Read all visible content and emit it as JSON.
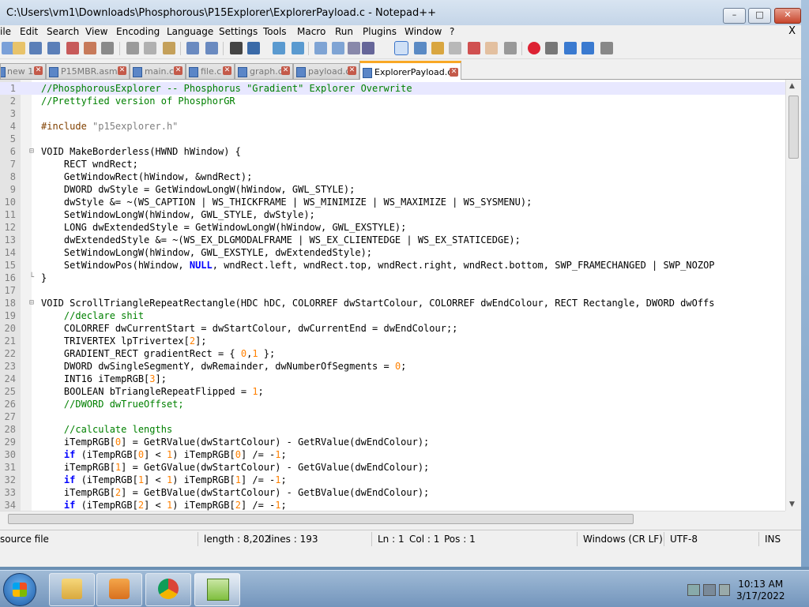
{
  "window": {
    "title": "C:\\Users\\vm1\\Downloads\\Phosphorous\\P15Explorer\\ExplorerPayload.c - Notepad++",
    "min_label": "–",
    "max_label": "□",
    "close_label": "✕"
  },
  "menu": {
    "items": [
      "ile",
      "Edit",
      "Search",
      "View",
      "Encoding",
      "Language",
      "Settings",
      "Tools",
      "Macro",
      "Run",
      "Plugins",
      "Window",
      "?"
    ],
    "close_doc": "X"
  },
  "tabs": [
    {
      "label": "new 1",
      "active": false
    },
    {
      "label": "P15MBR.asm",
      "active": false
    },
    {
      "label": "main.c",
      "active": false
    },
    {
      "label": "file.c",
      "active": false
    },
    {
      "label": "graph.c",
      "active": false
    },
    {
      "label": "payload.c",
      "active": false
    },
    {
      "label": "ExplorerPayload.c",
      "active": true
    }
  ],
  "tab_close_glyph": "✕",
  "code_lines": [
    {
      "n": "1",
      "fold": "",
      "html": "<span class=\"c\">//PhosphorousExplorer -- Phosphorus \"Gradient\" Explorer Overwrite</span>"
    },
    {
      "n": "2",
      "fold": "",
      "html": "<span class=\"c\">//Prettyfied version of PhosphorGR</span>"
    },
    {
      "n": "3",
      "fold": "",
      "html": ""
    },
    {
      "n": "4",
      "fold": "",
      "html": "<span class=\"pp\">#include </span><span class=\"s\">\"p15explorer.h\"</span>"
    },
    {
      "n": "5",
      "fold": "",
      "html": ""
    },
    {
      "n": "6",
      "fold": "⊟",
      "html": "VOID MakeBorderless(HWND hWindow) {"
    },
    {
      "n": "7",
      "fold": "",
      "html": "    RECT wndRect;"
    },
    {
      "n": "8",
      "fold": "",
      "html": "    GetWindowRect(hWindow, &amp;wndRect);"
    },
    {
      "n": "9",
      "fold": "",
      "html": "    DWORD dwStyle = GetWindowLongW(hWindow, GWL_STYLE);"
    },
    {
      "n": "10",
      "fold": "",
      "html": "    dwStyle &amp;= ~(WS_CAPTION | WS_THICKFRAME | WS_MINIMIZE | WS_MAXIMIZE | WS_SYSMENU);"
    },
    {
      "n": "11",
      "fold": "",
      "html": "    SetWindowLongW(hWindow, GWL_STYLE, dwStyle);"
    },
    {
      "n": "12",
      "fold": "",
      "html": "    LONG dwExtendedStyle = GetWindowLongW(hWindow, GWL_EXSTYLE);"
    },
    {
      "n": "13",
      "fold": "",
      "html": "    dwExtendedStyle &amp;= ~(WS_EX_DLGMODALFRAME | WS_EX_CLIENTEDGE | WS_EX_STATICEDGE);"
    },
    {
      "n": "14",
      "fold": "",
      "html": "    SetWindowLongW(hWindow, GWL_EXSTYLE, dwExtendedStyle);"
    },
    {
      "n": "15",
      "fold": "",
      "html": "    SetWindowPos(hWindow, <span class=\"k\">NULL</span>, wndRect.left, wndRect.top, wndRect.right, wndRect.bottom, SWP_FRAMECHANGED | SWP_NOZOP"
    },
    {
      "n": "16",
      "fold": "└",
      "html": "}"
    },
    {
      "n": "17",
      "fold": "",
      "html": ""
    },
    {
      "n": "18",
      "fold": "⊟",
      "html": "VOID ScrollTriangleRepeatRectangle(HDC hDC, COLORREF dwStartColour, COLORREF dwEndColour, RECT Rectangle, DWORD dwOffs"
    },
    {
      "n": "19",
      "fold": "",
      "html": "    <span class=\"c\">//declare shit</span>"
    },
    {
      "n": "20",
      "fold": "",
      "html": "    COLORREF dwCurrentStart = dwStartColour, dwCurrentEnd = dwEndColour;;"
    },
    {
      "n": "21",
      "fold": "",
      "html": "    TRIVERTEX lpTrivertex[<span class=\"num\">2</span>];"
    },
    {
      "n": "22",
      "fold": "",
      "html": "    GRADIENT_RECT gradientRect = { <span class=\"num\">0</span>,<span class=\"num\">1</span> };"
    },
    {
      "n": "23",
      "fold": "",
      "html": "    DWORD dwSingleSegmentY, dwRemainder, dwNumberOfSegments = <span class=\"num\">0</span>;"
    },
    {
      "n": "24",
      "fold": "",
      "html": "    INT16 iTempRGB[<span class=\"num\">3</span>];"
    },
    {
      "n": "25",
      "fold": "",
      "html": "    BOOLEAN bTriangleRepeatFlipped = <span class=\"num\">1</span>;"
    },
    {
      "n": "26",
      "fold": "",
      "html": "    <span class=\"c\">//DWORD dwTrueOffset;</span>"
    },
    {
      "n": "27",
      "fold": "",
      "html": ""
    },
    {
      "n": "28",
      "fold": "",
      "html": "    <span class=\"c\">//calculate lengths</span>"
    },
    {
      "n": "29",
      "fold": "",
      "html": "    iTempRGB[<span class=\"num\">0</span>] = GetRValue(dwStartColour) - GetRValue(dwEndColour);"
    },
    {
      "n": "30",
      "fold": "",
      "html": "    <span class=\"k\">if</span> (iTempRGB[<span class=\"num\">0</span>] &lt; <span class=\"num\">1</span>) iTempRGB[<span class=\"num\">0</span>] /= -<span class=\"num\">1</span>;"
    },
    {
      "n": "31",
      "fold": "",
      "html": "    iTempRGB[<span class=\"num\">1</span>] = GetGValue(dwStartColour) - GetGValue(dwEndColour);"
    },
    {
      "n": "32",
      "fold": "",
      "html": "    <span class=\"k\">if</span> (iTempRGB[<span class=\"num\">1</span>] &lt; <span class=\"num\">1</span>) iTempRGB[<span class=\"num\">1</span>] /= -<span class=\"num\">1</span>;"
    },
    {
      "n": "33",
      "fold": "",
      "html": "    iTempRGB[<span class=\"num\">2</span>] = GetBValue(dwStartColour) - GetBValue(dwEndColour);"
    },
    {
      "n": "34",
      "fold": "",
      "html": "    <span class=\"k\">if</span> (iTempRGB[<span class=\"num\">2</span>] &lt; <span class=\"num\">1</span>) iTempRGB[<span class=\"num\">2</span>] /= -<span class=\"num\">1</span>;"
    }
  ],
  "statusbar": {
    "type": "source file",
    "length": "length : 8,202",
    "lines": "lines : 193",
    "ln": "Ln : 1",
    "col": "Col : 1",
    "pos": "Pos : 1",
    "eol": "Windows (CR LF)",
    "encoding": "UTF-8",
    "mode": "INS"
  },
  "taskbar": {
    "time": "10:13 AM",
    "date": "3/17/2022"
  },
  "colors": {
    "comment": "#008000",
    "keyword": "#0000ff",
    "number": "#ff8000",
    "active_tab_accent": "#f9a825"
  }
}
